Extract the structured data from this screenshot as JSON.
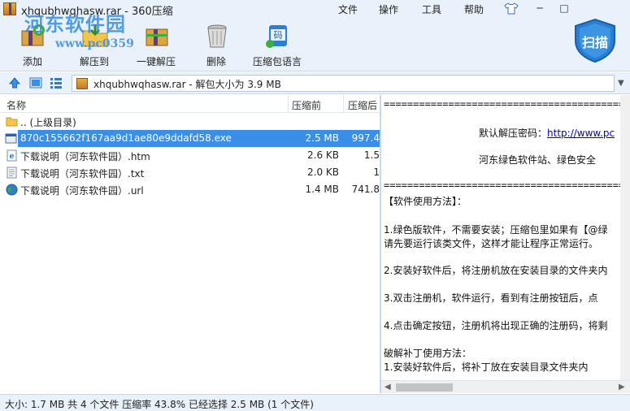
{
  "window": {
    "title": "xhqubhwqhasw.rar - 360压缩",
    "menu": [
      "文件",
      "操作",
      "工具",
      "帮助"
    ],
    "minimize": "─",
    "maximize": "□"
  },
  "watermark": {
    "text": "河东软件园",
    "url": "www.pc0359"
  },
  "toolbar": {
    "buttons": [
      {
        "label": "添加",
        "icon": "add-icon"
      },
      {
        "label": "解压到",
        "icon": "extract-to-icon"
      },
      {
        "label": "一键解压",
        "icon": "one-click-extract-icon"
      },
      {
        "label": "删除",
        "icon": "delete-icon"
      },
      {
        "label": "压缩包语言",
        "icon": "archive-language-icon"
      }
    ],
    "scan_label": "扫描"
  },
  "address": {
    "text": "xhqubhwqhasw.rar - 解包大小为 3.9 MB"
  },
  "filelist": {
    "columns": {
      "name": "名称",
      "size": "压缩前",
      "packed": "压缩后"
    },
    "rows": [
      {
        "name": ".. (上级目录)",
        "size": "",
        "packed": "",
        "icon": "folder-icon",
        "selected": false
      },
      {
        "name": "870c155662f167aa9d1ae80e9ddafd58.exe",
        "size": "2.5 MB",
        "packed": "997.4",
        "icon": "exe-icon",
        "selected": true
      },
      {
        "name": "下载说明（河东软件园）.htm",
        "size": "2.6 KB",
        "packed": "1.5",
        "icon": "ie-htm-icon",
        "selected": false
      },
      {
        "name": "下载说明（河东软件园）.txt",
        "size": "2.0 KB",
        "packed": "1",
        "icon": "txt-icon",
        "selected": false
      },
      {
        "name": "下载说明（河东软件园）.url",
        "size": "1.4 MB",
        "packed": "741.8",
        "icon": "globe-url-icon",
        "selected": false
      }
    ]
  },
  "preview": {
    "separator": "==================================================",
    "password_label": "默认解压密码：",
    "password_link": "http://www.pc",
    "site_line": "河东绿色软件站、绿色安全",
    "lines": [
      "【软件使用方法】：",
      "1.绿色版软件，不需要安装；压缩包里如果有【@绿",
      " 请先要运行该类文件，这样才能让程序正常运行。",
      "2.安装好软件后，将注册机放在安装目录的文件夹内",
      "3.双击注册机，软件运行，看到有注册按钮后，点",
      "4.点击确定按钮，注册机将出现正确的注册码，将剩",
      "破解补丁使用方法：",
      "1.安装好软件后，将补丁放在安装目录文件夹内"
    ]
  },
  "status": {
    "text": "大小: 1.7 MB 共 4 个文件 压缩率 43.8% 已经选择 2.5 MB (1 个文件)"
  }
}
